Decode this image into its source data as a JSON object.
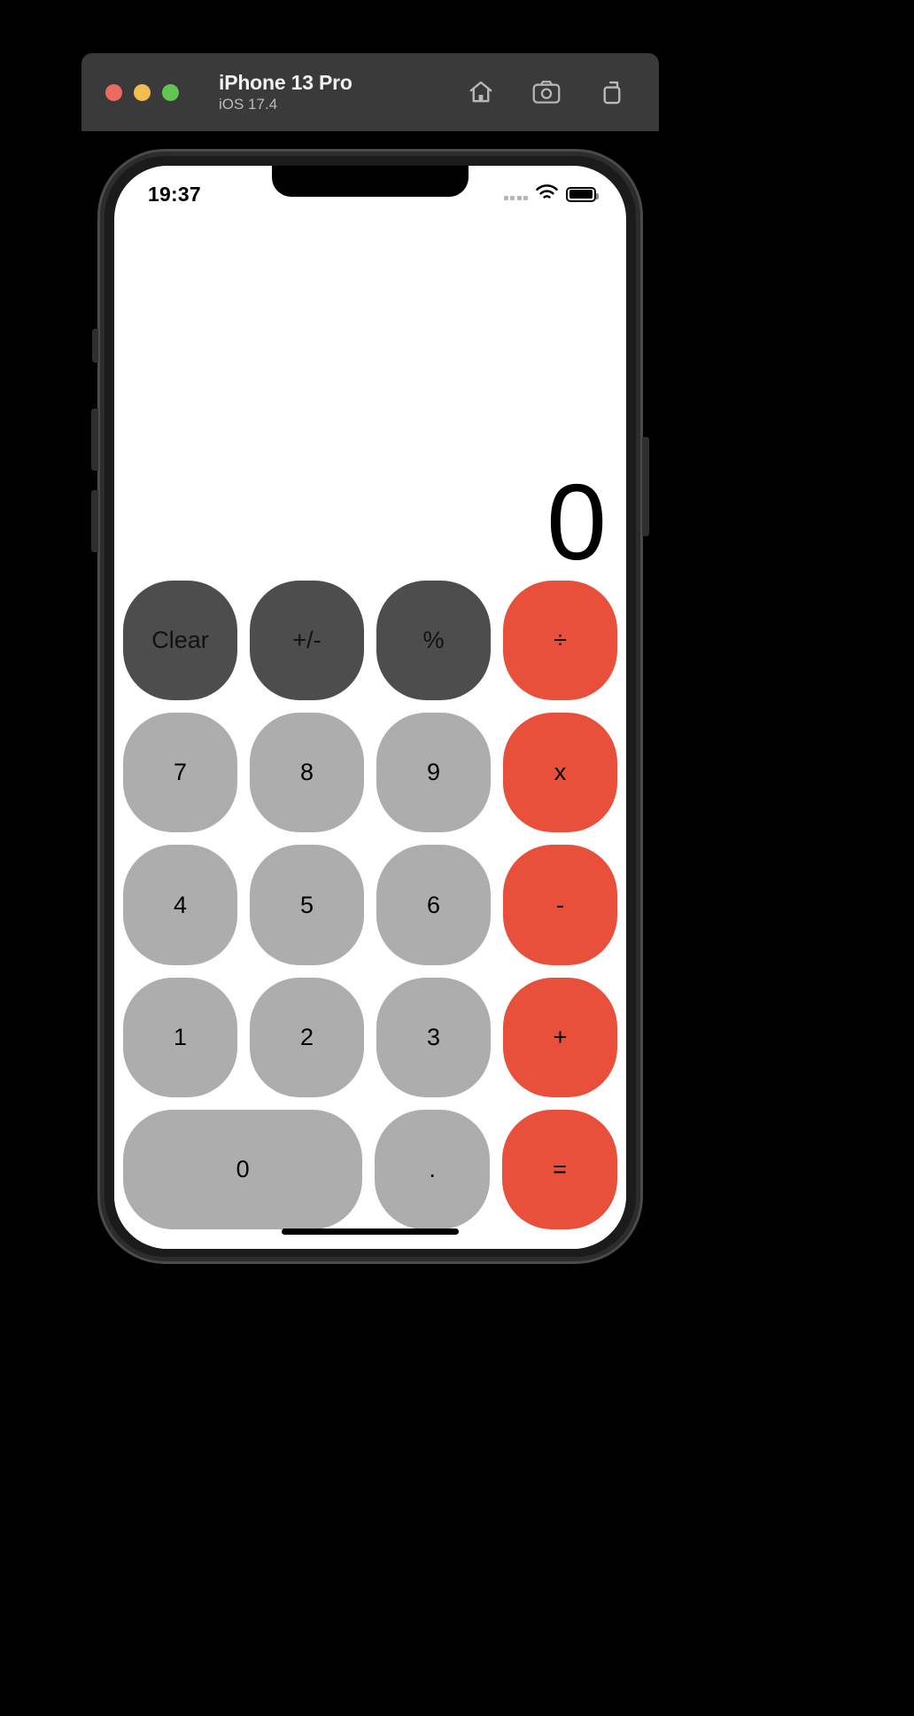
{
  "window": {
    "device_name": "iPhone 13 Pro",
    "os_version": "iOS 17.4",
    "traffic_lights": {
      "close": "close-button",
      "minimize": "minimize-button",
      "maximize": "maximize-button"
    },
    "actions": [
      {
        "name": "home-icon",
        "label": "Home"
      },
      {
        "name": "screenshot-icon",
        "label": "Screenshot"
      },
      {
        "name": "rotate-icon",
        "label": "Rotate"
      }
    ]
  },
  "status_bar": {
    "time": "19:37",
    "signal": "signal-dots-icon",
    "wifi": "wifi-icon",
    "battery": "battery-full-icon"
  },
  "calculator": {
    "display_value": "0",
    "rows": [
      [
        {
          "label": "Clear",
          "type": "fn",
          "name": "key-clear"
        },
        {
          "label": "+/-",
          "type": "fn",
          "name": "key-sign-toggle"
        },
        {
          "label": "%",
          "type": "fn",
          "name": "key-percent"
        },
        {
          "label": "÷",
          "type": "op",
          "name": "key-divide"
        }
      ],
      [
        {
          "label": "7",
          "type": "num",
          "name": "key-7"
        },
        {
          "label": "8",
          "type": "num",
          "name": "key-8"
        },
        {
          "label": "9",
          "type": "num",
          "name": "key-9"
        },
        {
          "label": "x",
          "type": "op",
          "name": "key-multiply"
        }
      ],
      [
        {
          "label": "4",
          "type": "num",
          "name": "key-4"
        },
        {
          "label": "5",
          "type": "num",
          "name": "key-5"
        },
        {
          "label": "6",
          "type": "num",
          "name": "key-6"
        },
        {
          "label": "-",
          "type": "op",
          "name": "key-minus"
        }
      ],
      [
        {
          "label": "1",
          "type": "num",
          "name": "key-1"
        },
        {
          "label": "2",
          "type": "num",
          "name": "key-2"
        },
        {
          "label": "3",
          "type": "num",
          "name": "key-3"
        },
        {
          "label": "+",
          "type": "op",
          "name": "key-plus"
        }
      ],
      [
        {
          "label": "0",
          "type": "num",
          "name": "key-0",
          "wide": true
        },
        {
          "label": ".",
          "type": "num",
          "name": "key-decimal"
        },
        {
          "label": "=",
          "type": "op",
          "name": "key-equals"
        }
      ]
    ]
  },
  "colors": {
    "function_key": "#4d4d4d",
    "number_key": "#adadad",
    "operator_key": "#e8503c",
    "screen_background": "#ffffff",
    "titlebar": "#3a3a3a",
    "desktop": "#000000"
  }
}
